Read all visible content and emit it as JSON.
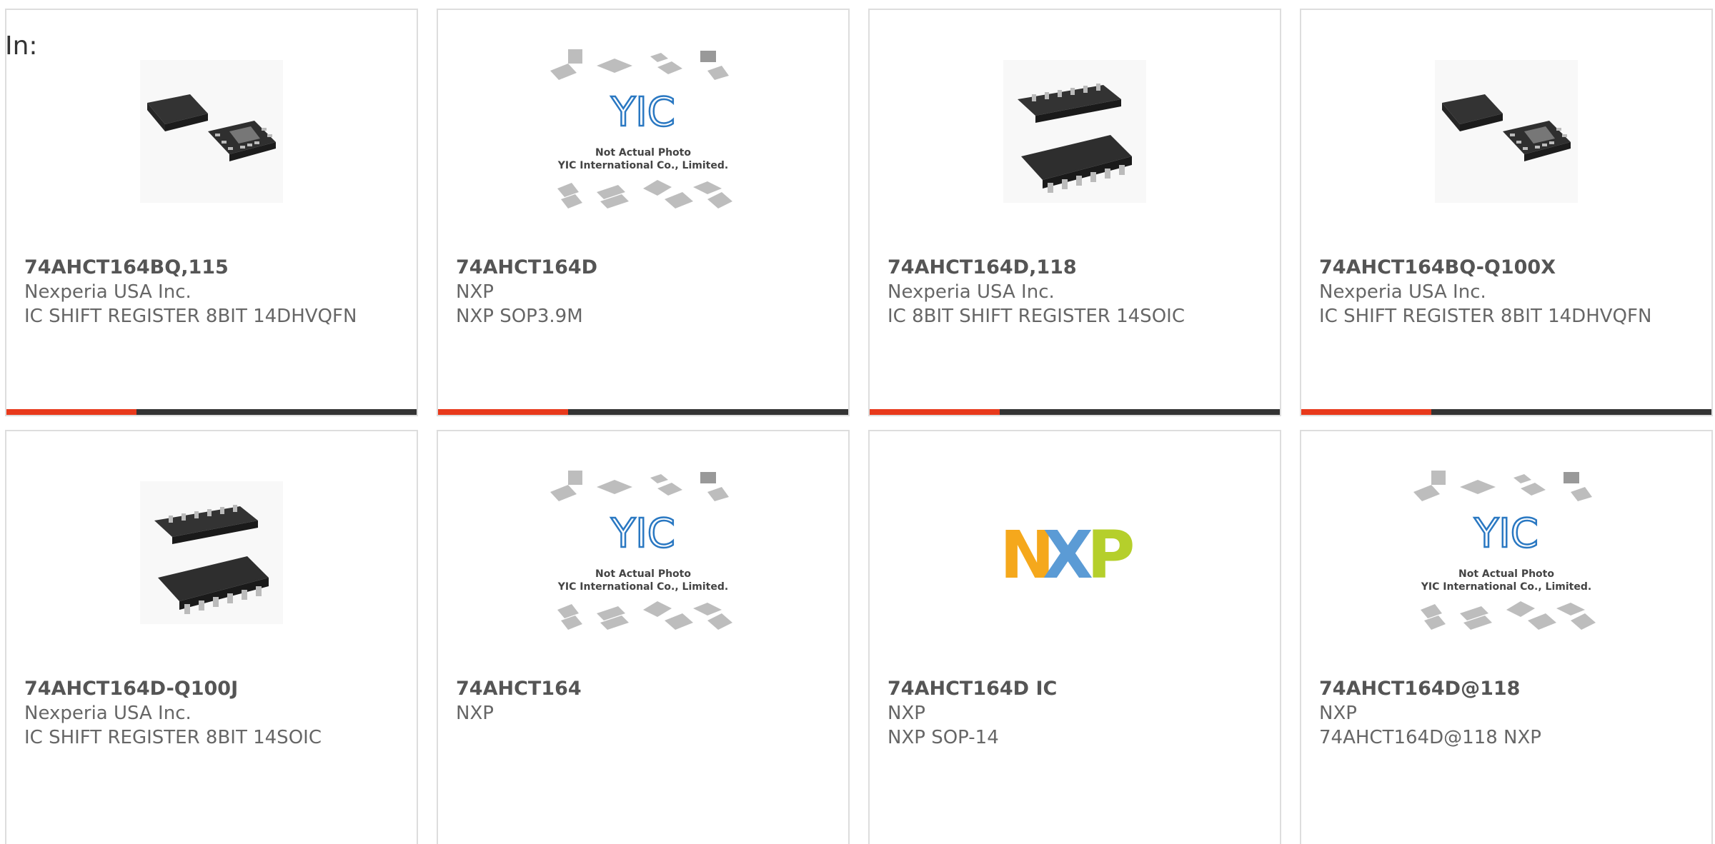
{
  "header": {
    "in_label": "In:"
  },
  "colors": {
    "accent": "#e8391b",
    "bar": "#3a3a3a",
    "border": "#dddddd"
  },
  "placeholder": {
    "line1": "Not Actual Photo",
    "line2": "YIC International Co., Limited.",
    "logo": "YIC"
  },
  "nxp_logo": {
    "letters": [
      "N",
      "X",
      "P"
    ]
  },
  "products": [
    {
      "part": "74AHCT164BQ,115",
      "manufacturer": "Nexperia USA Inc.",
      "description": "IC SHIFT REGISTER 8BIT 14DHVQFN",
      "image": "qfn-chip-image"
    },
    {
      "part": "74AHCT164D",
      "manufacturer": "NXP",
      "description": "NXP SOP3.9M",
      "image": "yic-placeholder-image"
    },
    {
      "part": "74AHCT164D,118",
      "manufacturer": "Nexperia USA Inc.",
      "description": "IC 8BIT SHIFT REGISTER 14SOIC",
      "image": "soic-chip-image"
    },
    {
      "part": "74AHCT164BQ-Q100X",
      "manufacturer": "Nexperia USA Inc.",
      "description": "IC SHIFT REGISTER 8BIT 14DHVQFN",
      "image": "qfn-chip-image"
    },
    {
      "part": "74AHCT164D-Q100J",
      "manufacturer": "Nexperia USA Inc.",
      "description": "IC SHIFT REGISTER 8BIT 14SOIC",
      "image": "soic-chip-image"
    },
    {
      "part": "74AHCT164",
      "manufacturer": "NXP",
      "description": "",
      "image": "yic-placeholder-image"
    },
    {
      "part": "74AHCT164D IC",
      "manufacturer": "NXP",
      "description": "NXP SOP-14",
      "image": "nxp-logo-image"
    },
    {
      "part": "74AHCT164D@118",
      "manufacturer": "NXP",
      "description": "74AHCT164D@118 NXP",
      "image": "yic-placeholder-image"
    }
  ]
}
